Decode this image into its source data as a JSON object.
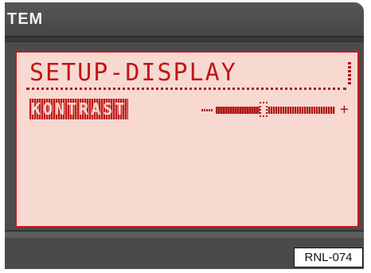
{
  "header": {
    "system_label": "TEM"
  },
  "screen": {
    "title": "SETUP-DISPLAY",
    "setting_label": "KONTRAST",
    "slider": {
      "minus_symbol": "-",
      "plus_symbol": "+",
      "value_fraction": 0.4
    }
  },
  "footer": {
    "reference_code": "RNL-074"
  },
  "colors": {
    "lcd_background": "#f7d9d2",
    "lcd_text": "#c01818",
    "bezel": "#3c3c3c"
  }
}
